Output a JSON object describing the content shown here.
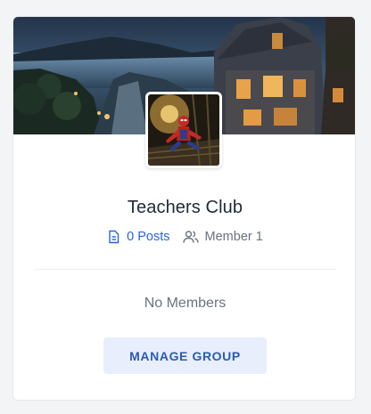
{
  "group": {
    "name": "Teachers Club",
    "posts_label": "0 Posts",
    "members_label": "Member 1",
    "no_members_text": "No Members",
    "manage_button_label": "MANAGE GROUP"
  },
  "icons": {
    "posts": "document-icon",
    "members": "users-icon"
  },
  "colors": {
    "accent": "#2563eb",
    "button_bg": "#e8eefb",
    "button_text": "#2b5bb5",
    "muted_text": "#6b7280",
    "title_text": "#1f2937"
  }
}
